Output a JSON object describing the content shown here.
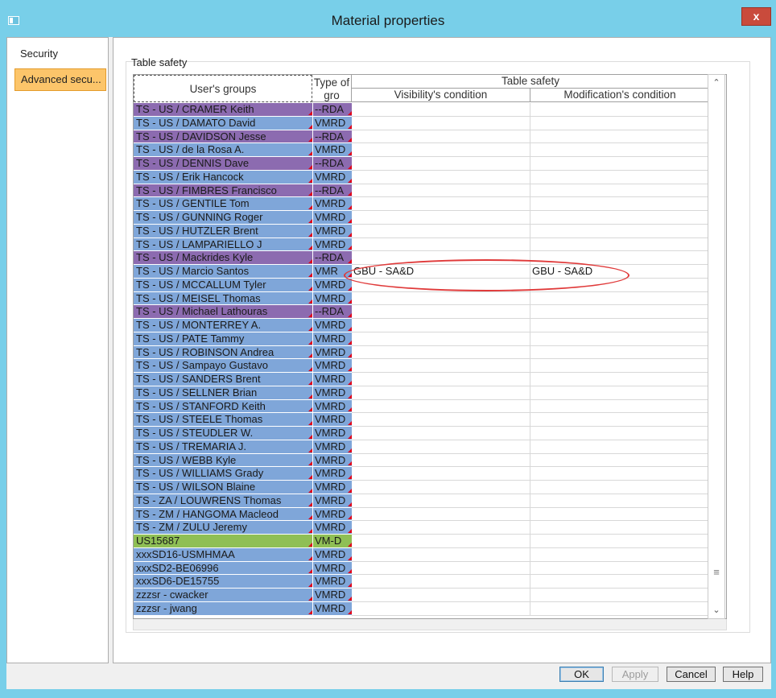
{
  "window": {
    "title": "Material properties",
    "close_label": "x"
  },
  "nav": {
    "items": [
      {
        "label": "Security"
      },
      {
        "label": "Advanced secu..."
      }
    ]
  },
  "group": {
    "label": "Table safety"
  },
  "grid": {
    "headers": {
      "users": "User's groups",
      "type": "Type of gro",
      "table_safety": "Table safety",
      "visibility": "Visibility's condition",
      "modification": "Modification's condition"
    },
    "rows": [
      {
        "user": "TS - US / CRAMER Keith",
        "type": "--RDA",
        "color": "purple",
        "vis": "",
        "mod": ""
      },
      {
        "user": "TS - US / DAMATO David",
        "type": "VMRD",
        "color": "blue",
        "vis": "",
        "mod": ""
      },
      {
        "user": "TS - US / DAVIDSON Jesse",
        "type": "--RDA",
        "color": "purple",
        "vis": "",
        "mod": ""
      },
      {
        "user": "TS - US / de la Rosa A.",
        "type": "VMRD",
        "color": "blue",
        "vis": "",
        "mod": ""
      },
      {
        "user": "TS - US / DENNIS Dave",
        "type": "--RDA",
        "color": "purple",
        "vis": "",
        "mod": ""
      },
      {
        "user": "TS - US / Erik Hancock",
        "type": "VMRD",
        "color": "blue",
        "vis": "",
        "mod": ""
      },
      {
        "user": "TS - US / FIMBRES Francisco",
        "type": "--RDA",
        "color": "purple",
        "vis": "",
        "mod": ""
      },
      {
        "user": "TS - US / GENTILE Tom",
        "type": "VMRD",
        "color": "blue",
        "vis": "",
        "mod": ""
      },
      {
        "user": "TS - US / GUNNING Roger",
        "type": "VMRD",
        "color": "blue",
        "vis": "",
        "mod": ""
      },
      {
        "user": "TS - US / HUTZLER Brent",
        "type": "VMRD",
        "color": "blue",
        "vis": "",
        "mod": ""
      },
      {
        "user": "TS - US / LAMPARIELLO J",
        "type": "VMRD",
        "color": "blue",
        "vis": "",
        "mod": ""
      },
      {
        "user": "TS - US / Mackrides Kyle",
        "type": "--RDA",
        "color": "purple",
        "vis": "",
        "mod": ""
      },
      {
        "user": "TS - US / Marcio Santos",
        "type": "VMR",
        "color": "blue",
        "vis": "GBU - SA&D",
        "mod": "GBU - SA&D"
      },
      {
        "user": "TS - US / MCCALLUM Tyler",
        "type": "VMRD",
        "color": "blue",
        "vis": "",
        "mod": ""
      },
      {
        "user": "TS - US / MEISEL Thomas",
        "type": "VMRD",
        "color": "blue",
        "vis": "",
        "mod": ""
      },
      {
        "user": "TS - US / Michael Lathouras",
        "type": "--RDA",
        "color": "purple",
        "vis": "",
        "mod": ""
      },
      {
        "user": "TS - US / MONTERREY A.",
        "type": "VMRD",
        "color": "blue",
        "vis": "",
        "mod": ""
      },
      {
        "user": "TS - US / PATE Tammy",
        "type": "VMRD",
        "color": "blue",
        "vis": "",
        "mod": ""
      },
      {
        "user": "TS - US / ROBINSON Andrea",
        "type": "VMRD",
        "color": "blue",
        "vis": "",
        "mod": ""
      },
      {
        "user": "TS - US / Sampayo Gustavo",
        "type": "VMRD",
        "color": "blue",
        "vis": "",
        "mod": ""
      },
      {
        "user": "TS - US / SANDERS Brent",
        "type": "VMRD",
        "color": "blue",
        "vis": "",
        "mod": ""
      },
      {
        "user": "TS - US / SELLNER Brian",
        "type": "VMRD",
        "color": "blue",
        "vis": "",
        "mod": ""
      },
      {
        "user": "TS - US / STANFORD Keith",
        "type": "VMRD",
        "color": "blue",
        "vis": "",
        "mod": ""
      },
      {
        "user": "TS - US / STEELE Thomas",
        "type": "VMRD",
        "color": "blue",
        "vis": "",
        "mod": ""
      },
      {
        "user": "TS - US / STEUDLER W.",
        "type": "VMRD",
        "color": "blue",
        "vis": "",
        "mod": ""
      },
      {
        "user": "TS - US / TREMARIA J.",
        "type": "VMRD",
        "color": "blue",
        "vis": "",
        "mod": ""
      },
      {
        "user": "TS - US / WEBB Kyle",
        "type": "VMRD",
        "color": "blue",
        "vis": "",
        "mod": ""
      },
      {
        "user": "TS - US / WILLIAMS Grady",
        "type": "VMRD",
        "color": "blue",
        "vis": "",
        "mod": ""
      },
      {
        "user": "TS - US / WILSON Blaine",
        "type": "VMRD",
        "color": "blue",
        "vis": "",
        "mod": ""
      },
      {
        "user": "TS - ZA / LOUWRENS Thomas",
        "type": "VMRD",
        "color": "blue",
        "vis": "",
        "mod": ""
      },
      {
        "user": "TS - ZM / HANGOMA Macleod",
        "type": "VMRD",
        "color": "blue",
        "vis": "",
        "mod": ""
      },
      {
        "user": "TS - ZM / ZULU Jeremy",
        "type": "VMRD",
        "color": "blue",
        "vis": "",
        "mod": ""
      },
      {
        "user": "US15687",
        "type": "VM-D",
        "color": "green",
        "vis": "",
        "mod": ""
      },
      {
        "user": "xxxSD16-USMHMAA",
        "type": "VMRD",
        "color": "blue",
        "vis": "",
        "mod": ""
      },
      {
        "user": "xxxSD2-BE06996",
        "type": "VMRD",
        "color": "blue",
        "vis": "",
        "mod": ""
      },
      {
        "user": "xxxSD6-DE15755",
        "type": "VMRD",
        "color": "blue",
        "vis": "",
        "mod": ""
      },
      {
        "user": "zzzsr - cwacker",
        "type": "VMRD",
        "color": "blue",
        "vis": "",
        "mod": ""
      },
      {
        "user": "zzzsr - jwang",
        "type": "VMRD",
        "color": "blue",
        "vis": "",
        "mod": ""
      }
    ]
  },
  "buttons": {
    "ok": "OK",
    "apply": "Apply",
    "cancel": "Cancel",
    "help": "Help"
  },
  "icons": {
    "scroll_up": "scroll-up-arrow-icon",
    "scroll_down": "scroll-down-arrow-icon",
    "grip": "scroll-grip-icon"
  },
  "colors": {
    "title_bar": "#78cfe9",
    "selected_nav": "#fcc56a",
    "row_blue": "#7fa6d9",
    "row_purple": "#8c6bb0",
    "row_green": "#8fbf55",
    "highlight": "#e03a3a"
  }
}
